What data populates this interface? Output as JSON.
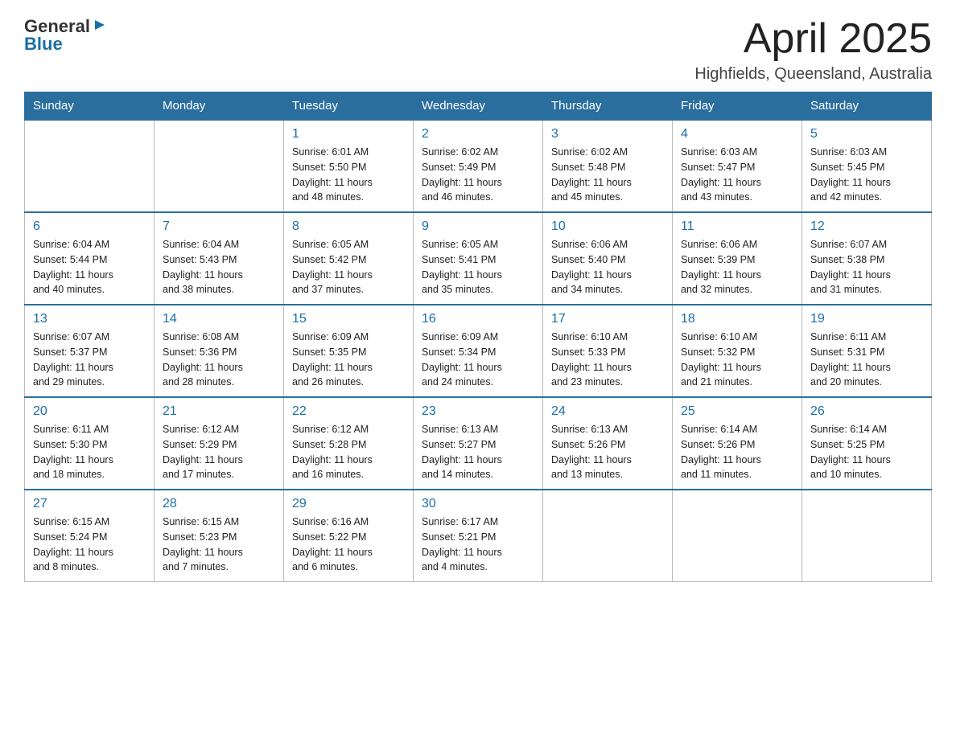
{
  "header": {
    "logo_general": "General",
    "logo_blue": "Blue",
    "month_title": "April 2025",
    "location": "Highfields, Queensland, Australia"
  },
  "days_of_week": [
    "Sunday",
    "Monday",
    "Tuesday",
    "Wednesday",
    "Thursday",
    "Friday",
    "Saturday"
  ],
  "weeks": [
    [
      {
        "day": "",
        "info": ""
      },
      {
        "day": "",
        "info": ""
      },
      {
        "day": "1",
        "info": "Sunrise: 6:01 AM\nSunset: 5:50 PM\nDaylight: 11 hours\nand 48 minutes."
      },
      {
        "day": "2",
        "info": "Sunrise: 6:02 AM\nSunset: 5:49 PM\nDaylight: 11 hours\nand 46 minutes."
      },
      {
        "day": "3",
        "info": "Sunrise: 6:02 AM\nSunset: 5:48 PM\nDaylight: 11 hours\nand 45 minutes."
      },
      {
        "day": "4",
        "info": "Sunrise: 6:03 AM\nSunset: 5:47 PM\nDaylight: 11 hours\nand 43 minutes."
      },
      {
        "day": "5",
        "info": "Sunrise: 6:03 AM\nSunset: 5:45 PM\nDaylight: 11 hours\nand 42 minutes."
      }
    ],
    [
      {
        "day": "6",
        "info": "Sunrise: 6:04 AM\nSunset: 5:44 PM\nDaylight: 11 hours\nand 40 minutes."
      },
      {
        "day": "7",
        "info": "Sunrise: 6:04 AM\nSunset: 5:43 PM\nDaylight: 11 hours\nand 38 minutes."
      },
      {
        "day": "8",
        "info": "Sunrise: 6:05 AM\nSunset: 5:42 PM\nDaylight: 11 hours\nand 37 minutes."
      },
      {
        "day": "9",
        "info": "Sunrise: 6:05 AM\nSunset: 5:41 PM\nDaylight: 11 hours\nand 35 minutes."
      },
      {
        "day": "10",
        "info": "Sunrise: 6:06 AM\nSunset: 5:40 PM\nDaylight: 11 hours\nand 34 minutes."
      },
      {
        "day": "11",
        "info": "Sunrise: 6:06 AM\nSunset: 5:39 PM\nDaylight: 11 hours\nand 32 minutes."
      },
      {
        "day": "12",
        "info": "Sunrise: 6:07 AM\nSunset: 5:38 PM\nDaylight: 11 hours\nand 31 minutes."
      }
    ],
    [
      {
        "day": "13",
        "info": "Sunrise: 6:07 AM\nSunset: 5:37 PM\nDaylight: 11 hours\nand 29 minutes."
      },
      {
        "day": "14",
        "info": "Sunrise: 6:08 AM\nSunset: 5:36 PM\nDaylight: 11 hours\nand 28 minutes."
      },
      {
        "day": "15",
        "info": "Sunrise: 6:09 AM\nSunset: 5:35 PM\nDaylight: 11 hours\nand 26 minutes."
      },
      {
        "day": "16",
        "info": "Sunrise: 6:09 AM\nSunset: 5:34 PM\nDaylight: 11 hours\nand 24 minutes."
      },
      {
        "day": "17",
        "info": "Sunrise: 6:10 AM\nSunset: 5:33 PM\nDaylight: 11 hours\nand 23 minutes."
      },
      {
        "day": "18",
        "info": "Sunrise: 6:10 AM\nSunset: 5:32 PM\nDaylight: 11 hours\nand 21 minutes."
      },
      {
        "day": "19",
        "info": "Sunrise: 6:11 AM\nSunset: 5:31 PM\nDaylight: 11 hours\nand 20 minutes."
      }
    ],
    [
      {
        "day": "20",
        "info": "Sunrise: 6:11 AM\nSunset: 5:30 PM\nDaylight: 11 hours\nand 18 minutes."
      },
      {
        "day": "21",
        "info": "Sunrise: 6:12 AM\nSunset: 5:29 PM\nDaylight: 11 hours\nand 17 minutes."
      },
      {
        "day": "22",
        "info": "Sunrise: 6:12 AM\nSunset: 5:28 PM\nDaylight: 11 hours\nand 16 minutes."
      },
      {
        "day": "23",
        "info": "Sunrise: 6:13 AM\nSunset: 5:27 PM\nDaylight: 11 hours\nand 14 minutes."
      },
      {
        "day": "24",
        "info": "Sunrise: 6:13 AM\nSunset: 5:26 PM\nDaylight: 11 hours\nand 13 minutes."
      },
      {
        "day": "25",
        "info": "Sunrise: 6:14 AM\nSunset: 5:26 PM\nDaylight: 11 hours\nand 11 minutes."
      },
      {
        "day": "26",
        "info": "Sunrise: 6:14 AM\nSunset: 5:25 PM\nDaylight: 11 hours\nand 10 minutes."
      }
    ],
    [
      {
        "day": "27",
        "info": "Sunrise: 6:15 AM\nSunset: 5:24 PM\nDaylight: 11 hours\nand 8 minutes."
      },
      {
        "day": "28",
        "info": "Sunrise: 6:15 AM\nSunset: 5:23 PM\nDaylight: 11 hours\nand 7 minutes."
      },
      {
        "day": "29",
        "info": "Sunrise: 6:16 AM\nSunset: 5:22 PM\nDaylight: 11 hours\nand 6 minutes."
      },
      {
        "day": "30",
        "info": "Sunrise: 6:17 AM\nSunset: 5:21 PM\nDaylight: 11 hours\nand 4 minutes."
      },
      {
        "day": "",
        "info": ""
      },
      {
        "day": "",
        "info": ""
      },
      {
        "day": "",
        "info": ""
      }
    ]
  ]
}
